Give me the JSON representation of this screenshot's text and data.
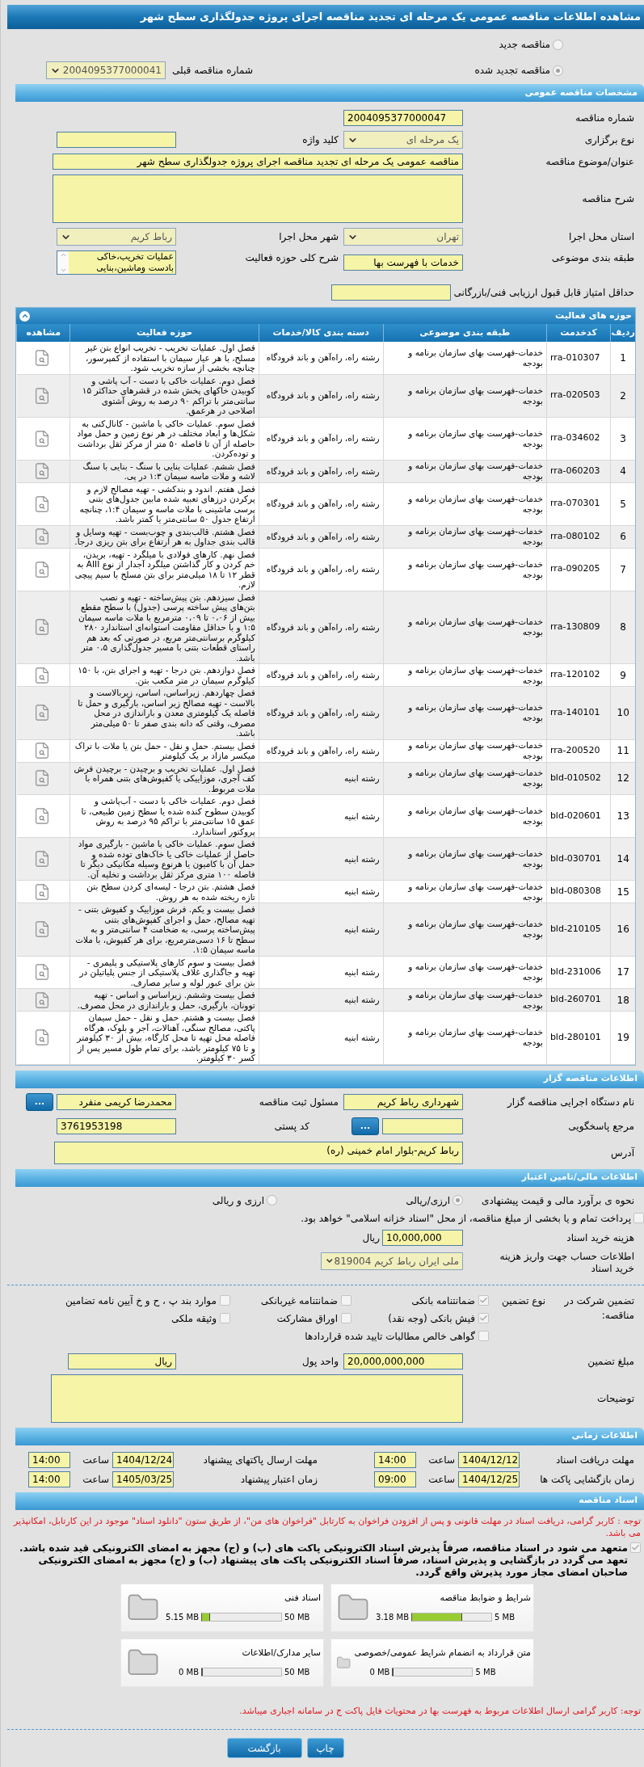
{
  "title": "مشاهده اطلاعات مناقصه عمومی یک مرحله ای تجدید مناقصه اجرای پروژه جدولگذاری سطح شهر",
  "tender_type": [
    {
      "label": "مناقصه جدید",
      "selected": false
    },
    {
      "label": "مناقصه تجدید شده",
      "selected": true
    }
  ],
  "previous_tender": {
    "label": "شماره مناقصه قبلی",
    "value": "2004095377000041"
  },
  "general": {
    "header": "مشخصات مناقصه عمومی",
    "tender_number": {
      "label": "شماره مناقصه",
      "value": "2004095377000047"
    },
    "holding_type": {
      "label": "نوع برگزاری",
      "value": "یک مرحله ای"
    },
    "keyword": {
      "label": "کلید واژه"
    },
    "subject": {
      "label": "عنوان/موضوع مناقصه",
      "value": "مناقصه عمومی یک مرحله ای تجدید مناقصه اجرای پروژه جدولگذاری سطح شهر"
    },
    "description": {
      "label": "شرح مناقصه"
    },
    "province": {
      "label": "استان محل اجرا",
      "value": "تهران"
    },
    "city": {
      "label": "شهر محل اجرا",
      "value": "رباط کریم"
    },
    "category": {
      "label": "طبقه بندی موضوعی",
      "value": "خدمات با فهرست بها"
    },
    "activity_scope": {
      "label": "شرح کلی حوزه فعالیت",
      "value": "عملیات تخریب،خاکی بادست وماشین،بنایی"
    },
    "min_score": {
      "label": "حداقل امتیاز قابل قبول ارزیابی فنی/بازرگانی"
    }
  },
  "activities": {
    "header": "حوزه های فعالیت",
    "columns": [
      "ردیف",
      "کدخدمت",
      "طبقه بندی موضوعی",
      "دسته بندی کالا/خدمات",
      "حوزه فعالیت",
      "مشاهده"
    ],
    "rows": [
      {
        "index": "1",
        "code": "rra-010307",
        "category": "خدمات-فهرست بهای سازمان برنامه و بودجه",
        "group": "رشته راه، راه‌آهن و باند فرودگاه",
        "activity": "فصل اول. عملیات تخریب - تخریب انواع بتن غیر مسلح، با هر عیار سیمان با استفاده از کمپرسور، چنانچه بخشی از سازه تخریب شود."
      },
      {
        "index": "2",
        "code": "rra-020503",
        "category": "خدمات-فهرست بهای سازمان برنامه و بودجه",
        "group": "رشته راه، راه‌آهن و باند فرودگاه",
        "activity": "فصل دوم. عملیات خاکی با دست - آب پاشی و کوبیدن خاکهای پخش شده در قشرهای حداکثر ۱۵ سانتی‌متر با تراکم ۹۰ درصد به روش آشتوی اصلاحی در هرعمق."
      },
      {
        "index": "3",
        "code": "rra-034602",
        "category": "خدمات-فهرست بهای سازمان برنامه و بودجه",
        "group": "رشته راه، راه‌آهن و باند فرودگاه",
        "activity": "فصل سوم. عملیات خاکی با ماشین - کانال‌کنی به شکل‌ها و ابعاد مختلف در هر نوع زمین و حمل مواد حاصله از آن تا فاصله ۵۰ متر از مرکز ثقل برداشت و توده‌کردن."
      },
      {
        "index": "4",
        "code": "rra-060203",
        "category": "خدمات-فهرست بهای سازمان برنامه و بودجه",
        "group": "رشته راه، راه‌آهن و باند فرودگاه",
        "activity": "فصل ششم. عملیات بنایی با سنگ - بنایی با سنگ لاشه و ملات ماسه سیمان ۱:۳ در پی."
      },
      {
        "index": "5",
        "code": "rra-070301",
        "category": "خدمات-فهرست بهای سازمان برنامه و بودجه",
        "group": "رشته راه، راه‌آهن و باند فرودگاه",
        "activity": "فصل هفتم. اندود و بندکشی - تهیه مصالح لازم و پرکردن درزهای تعبیه شده مابین جدول‌های بتنی پرسی ماشینی با ملات ماسه و سیمان ۱:۴، چنانچه ارتفاع جدول ۵۰ سانتی‌متر یا کمتر باشد."
      },
      {
        "index": "6",
        "code": "rra-080102",
        "category": "خدمات-فهرست بهای سازمان برنامه و بودجه",
        "group": "رشته راه، راه‌آهن و باند فرودگاه",
        "activity": "فصل هشتم. قالب‌بندی و چوب‌بست - تهیه وسایل و قالب بندی جداول به هر ارتفاع برای بتن ریزی درجا."
      },
      {
        "index": "7",
        "code": "rra-090205",
        "category": "خدمات-فهرست بهای سازمان برنامه و بودجه",
        "group": "رشته راه، راه‌آهن و باند فرودگاه",
        "activity": "فصل نهم. کارهای فولادی با میلگرد - تهیه، بریدن، خم کردن و کار گذاشتن میلگرد آجدار از نوع AIII به قطر ۱۲ تا ۱۸ میلی‌متر برای بتن مسلح با سیم پیچی لازم."
      },
      {
        "index": "8",
        "code": "rra-130809",
        "category": "خدمات-فهرست بهای سازمان برنامه و بودجه",
        "group": "رشته راه، راه‌آهن و باند فرودگاه",
        "activity": "فصل سیزدهم. بتن پیش‌ساخته - تهیه و نصب بتن‌های پیش ساخته پرسی (جدول) با سطح مقطع بیش از ۰،۰۶ تا ۰،۰۹ مترمربع با ملات ماسه سیمان ۱:۵ و با حداقل مقاومت استوانه‌ای استاندارد ۲۸۰ کیلوگرم برسانتی‌متر مربع، در صورتی که بعد هم راستای قطعات بتنی با مسیر جدول‌گذاری ۰،۵ متر باشد."
      },
      {
        "index": "9",
        "code": "rra-120102",
        "category": "خدمات-فهرست بهای سازمان برنامه و بودجه",
        "group": "رشته راه، راه‌آهن و باند فرودگاه",
        "activity": "فصل دوازدهم. بتن درجا - تهیه و اجرای بتن، با ۱۵۰ کیلوگرم سیمان در متر مکعب بتن."
      },
      {
        "index": "10",
        "code": "rra-140101",
        "category": "خدمات-فهرست بهای سازمان برنامه و بودجه",
        "group": "رشته راه، راه‌آهن و باند فرودگاه",
        "activity": "فصل چهاردهم. زیراساس، اساس، زیربالاست و بالاست - تهیه مصالح زیر اساس، بارگیری و حمل تا فاصله یک کیلومتری معدن و باراندازی در محل مصرف، وقتی که دانه بندی صفر تا ۵۰ میلی‌متر باشد."
      },
      {
        "index": "11",
        "code": "rra-200520",
        "category": "خدمات-فهرست بهای سازمان برنامه و بودجه",
        "group": "رشته راه، راه‌آهن و باند فرودگاه",
        "activity": "فصل بیستم. حمل و نقل - حمل بتن یا ملات با تراک میکسر مازاد بر یک کیلومتر"
      },
      {
        "index": "12",
        "code": "bld-010502",
        "category": "خدمات-فهرست بهای سازمان برنامه و بودجه",
        "group": "رشته ابنیه",
        "activity": "فصل اول. عملیات تخریب و برچیدن - برچیدن فرش کف آجری، موزاییکی یا کفپوش‌های بتنی همراه با ملات مربوط."
      },
      {
        "index": "13",
        "code": "bld-020601",
        "category": "خدمات-فهرست بهای سازمان برنامه و بودجه",
        "group": "رشته ابنیه",
        "activity": "فصل دوم. عملیات خاکی با دست - آب‌پاشی و کوبیدن سطوح کنده شده یا سطح زمین طبیعی، تا عمق ۱۵ سانتی‌متر با تراکم ۹۵ درصد به روش پروکتور استاندارد."
      },
      {
        "index": "14",
        "code": "bld-030701",
        "category": "خدمات-فهرست بهای سازمان برنامه و بودجه",
        "group": "رشته ابنیه",
        "activity": "فصل سوم. عملیات خاکی با ماشین - بارگیری مواد حاصل از عملیات خاکی یا خاک‌های توده شده و حمل آن با کامیون یا هرنوع وسیله مکانیکی دیگر تا فاصله ۱۰۰ متری مرکز ثقل برداشت و تخلیه آن."
      },
      {
        "index": "15",
        "code": "bld-080308",
        "category": "خدمات-فهرست بهای سازمان برنامه و بودجه",
        "group": "رشته ابنیه",
        "activity": "فصل هشتم. بتن درجا - لیسه‌ای کردن سطح بتن تازه ریخته شده به هر روش."
      },
      {
        "index": "16",
        "code": "bld-210105",
        "category": "خدمات-فهرست بهای سازمان برنامه و بودجه",
        "group": "رشته ابنیه",
        "activity": "فصل بیست و یکم. فرش موزاییک و کفپوش بتنی - تهیه مصالح، حمل و اجرای کفپوش‌های بتنی پیش‌ساخته پرسی، به ضخامت ۴ سانتی‌متر و به سطح تا ۱۶ دسی‌مترمربع، برای هر کفپوش، با ملات ماسه سیمان ۱:۵."
      },
      {
        "index": "17",
        "code": "bld-231006",
        "category": "خدمات-فهرست بهای سازمان برنامه و بودجه",
        "group": "رشته ابنیه",
        "activity": "فصل بیست و سوم کارهای پلاستیکی و پلیمری - تهیه و جاگذاری غلاف پلاستیکی از جنس پلیاتیلن در بتن برای عبور لوله و سایر مصارف."
      },
      {
        "index": "18",
        "code": "bld-260701",
        "category": "خدمات-فهرست بهای سازمان برنامه و بودجه",
        "group": "رشته ابنیه",
        "activity": "فصل بیست وششم. زیراساس و اساس - تهیه توونان، بارگیری، حمل و باراندازی در محل مصرف."
      },
      {
        "index": "19",
        "code": "bld-280101",
        "category": "خدمات-فهرست بهای سازمان برنامه و بودجه",
        "group": "رشته ابنیه",
        "activity": "فصل بیست و هشتم. حمل و نقل - حمل سیمان پاکتی، مصالح سنگی، آهنالات، آجر و بلوک، هرگاه فاصله محل تهیه تا محل کارگاه، بیش از ۳۰ کیلومتر و تا ۷۵ کیلومتر باشد، برای تمام طول مسیر پس از کسر ۳۰ کیلومتر."
      }
    ]
  },
  "organizer": {
    "header": "اطلاعات مناقصه گزار",
    "agency": {
      "label": "نام دستگاه اجرایی مناقصه گزار",
      "value": "شهرداری رباط کریم"
    },
    "registrar": {
      "label": "مسئول ثبت مناقصه",
      "value": "محمدرضا کریمی منفرد",
      "button": "..."
    },
    "responder": {
      "label": "مرجع پاسخگویی",
      "button": "..."
    },
    "postal_code": {
      "label": "کد پستی",
      "value": "3761953198"
    },
    "address": {
      "label": "آدرس",
      "value": "رباط کریم-بلوار امام خمینی (ره)"
    }
  },
  "finance": {
    "header": "اطلاعات مالی/تامین اعتبار",
    "estimate_label": "نحوه ی برآورد مالی و قیمت پیشنهادی",
    "estimate_options": [
      {
        "label": "ارزی/ریالی",
        "selected": true
      },
      {
        "label": "ارزی و ریالی",
        "selected": false
      }
    ],
    "treasury": {
      "label": "پرداخت تمام و یا بخشی از مبلغ مناقصه، از محل \"اسناد خزانه اسلامی\" خواهد بود.",
      "checked": false
    },
    "doc_fee": {
      "label": "هزینه خرید اسناد",
      "value": "10,000,000",
      "unit": "ریال"
    },
    "account": {
      "label": "اطلاعات حساب جهت واریز هزینه خرید اسناد",
      "value": "ملی ایران رباط کریم 819004"
    },
    "guarantee_label": "تضمین شرکت در مناقصه:",
    "guarantee_type_label": "نوع تضمین",
    "guarantee_types": [
      {
        "label": "ضمانتنامه بانکی",
        "checked": true
      },
      {
        "label": "ضمانتنامه غیربانکی",
        "checked": false
      },
      {
        "label": "موارد بند پ ، ح و خ آیین نامه تضامین",
        "checked": false
      },
      {
        "label": "فیش بانکی (وجه نقد)",
        "checked": true
      },
      {
        "label": "اوراق مشارکت",
        "checked": false
      },
      {
        "label": "وثیقه ملکی",
        "checked": false
      },
      {
        "label": "گواهی خالص مطالبات تایید شده قراردادها",
        "checked": false
      }
    ],
    "guarantee_amount": {
      "label": "مبلغ تضمین",
      "value": "20,000,000,000"
    },
    "currency": {
      "label": "واحد پول",
      "value": "ریال"
    },
    "notes": {
      "label": "توضیحات"
    }
  },
  "timing": {
    "header": "اطلاعات زمانی",
    "items": [
      {
        "label": "مهلت دریافت اسناد",
        "date": "1404/12/12",
        "time_label": "ساعت",
        "time": "14:00"
      },
      {
        "label": "مهلت ارسال پاکتهای پیشنهاد",
        "date": "1404/12/24",
        "time_label": "ساعت",
        "time": "14:00"
      },
      {
        "label": "زمان بازگشایی پاکت ها",
        "date": "1404/12/25",
        "time_label": "ساعت",
        "time": "09:00"
      },
      {
        "label": "زمان اعتبار پیشنهاد",
        "date": "1405/03/25",
        "time_label": "ساعت",
        "time": "14:00"
      }
    ]
  },
  "documents": {
    "header": "اسناد مناقصه",
    "notice": "توجه : کاربر گرامی، دریافت اسناد در مهلت قانونی و پس از افزودن فراخوان به کارتابل \"فراخوان های من\"، از طریق ستون \"دانلود اسناد\" موجود در این کارتابل، امکانپذیر می باشد.",
    "commitment": {
      "label": "متعهد می شود در اسناد مناقصه، صرفاً پذیرش اسناد الکترونیکی پاکت های (ب) و (ج) مجهز به امضای الکترونیکی قید شده باشد. تعهد می گردد در بازگشایی و پذیرش اسناد، صرفاً اسناد الکترونیکی پاکت های پیشنهاد (ب) و (ج) مجهز به امضای الکترونیکی صاحبان امضای مجاز مورد پذیرش واقع گردد.",
      "checked": true
    },
    "files": [
      {
        "name": "شرایط و ضوابط مناقصه",
        "size": "3.18 MB",
        "max": "5 MB",
        "level": 0.636
      },
      {
        "name": "اسناد فنی",
        "size": "5.15 MB",
        "max": "50 MB",
        "level": 0.103
      },
      {
        "name": "متن قرارداد به انضمام شرایط عمومی/خصوصی",
        "size": "0 MB",
        "max": "5 MB",
        "level": 0
      },
      {
        "name": "سایر مدارک/اطلاعات",
        "size": "0 MB",
        "max": "50 MB",
        "level": 0
      }
    ],
    "price_notice": "توجه: کاربر گرامی ارسال اطلاعات مربوط به فهرست بها در محتویات فایل پاکت ج در سامانه اجباری میباشد."
  },
  "buttons": [
    {
      "label": "چاپ"
    },
    {
      "label": "بازگشت"
    }
  ]
}
